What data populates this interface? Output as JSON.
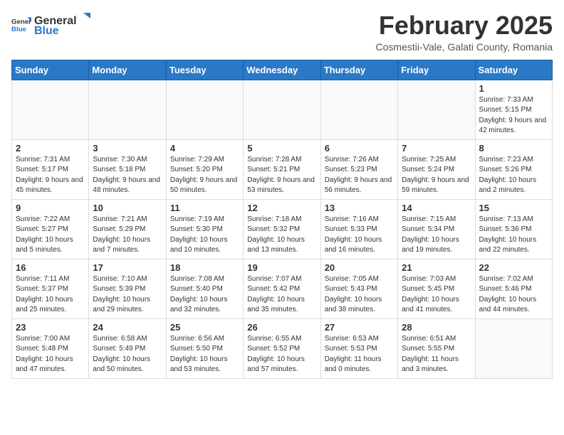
{
  "header": {
    "logo_general": "General",
    "logo_blue": "Blue",
    "month_title": "February 2025",
    "location": "Cosmestii-Vale, Galati County, Romania"
  },
  "weekdays": [
    "Sunday",
    "Monday",
    "Tuesday",
    "Wednesday",
    "Thursday",
    "Friday",
    "Saturday"
  ],
  "weeks": [
    [
      {
        "day": "",
        "info": ""
      },
      {
        "day": "",
        "info": ""
      },
      {
        "day": "",
        "info": ""
      },
      {
        "day": "",
        "info": ""
      },
      {
        "day": "",
        "info": ""
      },
      {
        "day": "",
        "info": ""
      },
      {
        "day": "1",
        "info": "Sunrise: 7:33 AM\nSunset: 5:15 PM\nDaylight: 9 hours and 42 minutes."
      }
    ],
    [
      {
        "day": "2",
        "info": "Sunrise: 7:31 AM\nSunset: 5:17 PM\nDaylight: 9 hours and 45 minutes."
      },
      {
        "day": "3",
        "info": "Sunrise: 7:30 AM\nSunset: 5:18 PM\nDaylight: 9 hours and 48 minutes."
      },
      {
        "day": "4",
        "info": "Sunrise: 7:29 AM\nSunset: 5:20 PM\nDaylight: 9 hours and 50 minutes."
      },
      {
        "day": "5",
        "info": "Sunrise: 7:28 AM\nSunset: 5:21 PM\nDaylight: 9 hours and 53 minutes."
      },
      {
        "day": "6",
        "info": "Sunrise: 7:26 AM\nSunset: 5:23 PM\nDaylight: 9 hours and 56 minutes."
      },
      {
        "day": "7",
        "info": "Sunrise: 7:25 AM\nSunset: 5:24 PM\nDaylight: 9 hours and 59 minutes."
      },
      {
        "day": "8",
        "info": "Sunrise: 7:23 AM\nSunset: 5:26 PM\nDaylight: 10 hours and 2 minutes."
      }
    ],
    [
      {
        "day": "9",
        "info": "Sunrise: 7:22 AM\nSunset: 5:27 PM\nDaylight: 10 hours and 5 minutes."
      },
      {
        "day": "10",
        "info": "Sunrise: 7:21 AM\nSunset: 5:29 PM\nDaylight: 10 hours and 7 minutes."
      },
      {
        "day": "11",
        "info": "Sunrise: 7:19 AM\nSunset: 5:30 PM\nDaylight: 10 hours and 10 minutes."
      },
      {
        "day": "12",
        "info": "Sunrise: 7:18 AM\nSunset: 5:32 PM\nDaylight: 10 hours and 13 minutes."
      },
      {
        "day": "13",
        "info": "Sunrise: 7:16 AM\nSunset: 5:33 PM\nDaylight: 10 hours and 16 minutes."
      },
      {
        "day": "14",
        "info": "Sunrise: 7:15 AM\nSunset: 5:34 PM\nDaylight: 10 hours and 19 minutes."
      },
      {
        "day": "15",
        "info": "Sunrise: 7:13 AM\nSunset: 5:36 PM\nDaylight: 10 hours and 22 minutes."
      }
    ],
    [
      {
        "day": "16",
        "info": "Sunrise: 7:11 AM\nSunset: 5:37 PM\nDaylight: 10 hours and 25 minutes."
      },
      {
        "day": "17",
        "info": "Sunrise: 7:10 AM\nSunset: 5:39 PM\nDaylight: 10 hours and 29 minutes."
      },
      {
        "day": "18",
        "info": "Sunrise: 7:08 AM\nSunset: 5:40 PM\nDaylight: 10 hours and 32 minutes."
      },
      {
        "day": "19",
        "info": "Sunrise: 7:07 AM\nSunset: 5:42 PM\nDaylight: 10 hours and 35 minutes."
      },
      {
        "day": "20",
        "info": "Sunrise: 7:05 AM\nSunset: 5:43 PM\nDaylight: 10 hours and 38 minutes."
      },
      {
        "day": "21",
        "info": "Sunrise: 7:03 AM\nSunset: 5:45 PM\nDaylight: 10 hours and 41 minutes."
      },
      {
        "day": "22",
        "info": "Sunrise: 7:02 AM\nSunset: 5:46 PM\nDaylight: 10 hours and 44 minutes."
      }
    ],
    [
      {
        "day": "23",
        "info": "Sunrise: 7:00 AM\nSunset: 5:48 PM\nDaylight: 10 hours and 47 minutes."
      },
      {
        "day": "24",
        "info": "Sunrise: 6:58 AM\nSunset: 5:49 PM\nDaylight: 10 hours and 50 minutes."
      },
      {
        "day": "25",
        "info": "Sunrise: 6:56 AM\nSunset: 5:50 PM\nDaylight: 10 hours and 53 minutes."
      },
      {
        "day": "26",
        "info": "Sunrise: 6:55 AM\nSunset: 5:52 PM\nDaylight: 10 hours and 57 minutes."
      },
      {
        "day": "27",
        "info": "Sunrise: 6:53 AM\nSunset: 5:53 PM\nDaylight: 11 hours and 0 minutes."
      },
      {
        "day": "28",
        "info": "Sunrise: 6:51 AM\nSunset: 5:55 PM\nDaylight: 11 hours and 3 minutes."
      },
      {
        "day": "",
        "info": ""
      }
    ]
  ]
}
